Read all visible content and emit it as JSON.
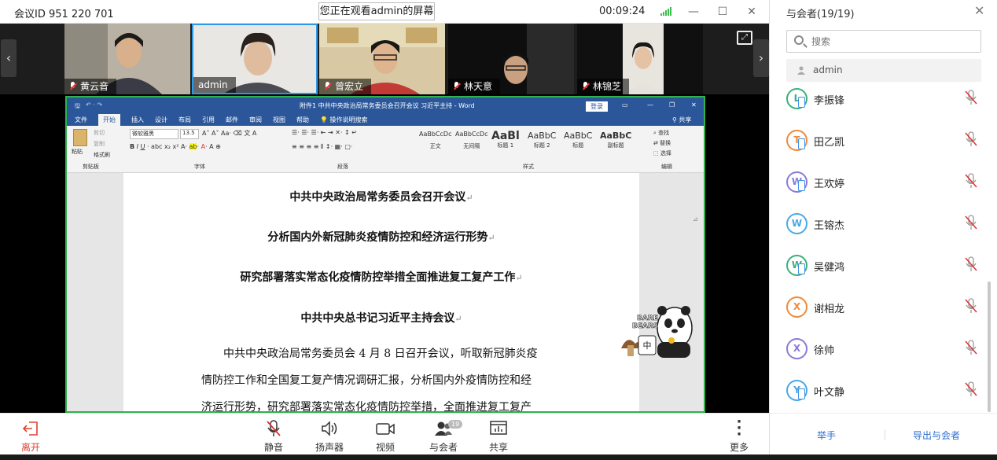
{
  "titlebar": {
    "meeting_id": "会议ID 951 220 701",
    "viewing": "您正在观看admin的屏幕",
    "timer": "00:09:24"
  },
  "video_strip": {
    "tiles": [
      {
        "name": "黄云音"
      },
      {
        "name": "admin"
      },
      {
        "name": "曾宏立"
      },
      {
        "name": "林天意"
      },
      {
        "name": "林锦芝"
      }
    ]
  },
  "word": {
    "title": "附件1  中共中央政治局常务委员会召开会议 习近平主持 - Word",
    "login": "登录",
    "tabs": [
      "文件",
      "开始",
      "插入",
      "设计",
      "布局",
      "引用",
      "邮件",
      "审阅",
      "视图",
      "帮助",
      "操作说明搜索"
    ],
    "share": "共享",
    "font_name": "微软雅黑",
    "font_size": "13.5",
    "paste": "粘贴",
    "cut": "剪切",
    "copy": "复制",
    "format_painter": "格式刷",
    "find": "查找",
    "replace": "替换",
    "select": "选择",
    "groups": [
      "剪贴板",
      "字体",
      "段落",
      "样式",
      "编辑"
    ],
    "styles": [
      {
        "sample": "AaBbCcDc",
        "name": "正文"
      },
      {
        "sample": "AaBbCcDc",
        "name": "无间隔"
      },
      {
        "sample": "AaBl",
        "name": "标题 1"
      },
      {
        "sample": "AaBbC",
        "name": "标题 2"
      },
      {
        "sample": "AaBbC",
        "name": "标题"
      },
      {
        "sample": "AaBbC",
        "name": "副标题"
      }
    ],
    "doc": {
      "h1": "中共中央政治局常务委员会召开会议",
      "h2": "分析国内外新冠肺炎疫情防控和经济运行形势",
      "h3": "研究部署落实常态化疫情防控举措全面推进复工复产工作",
      "h4": "中共中央总书记习近平主持会议",
      "p1": "中共中央政治局常务委员会 4 月 8 日召开会议，听取新冠肺炎疫",
      "p2": "情防控工作和全国复工复产情况调研汇报，分析国内外疫情防控和经",
      "p3": "济运行形势，研究部署落实常态化疫情防控举措，全面推进复工复产",
      "return_mark": "↵"
    },
    "sticker": {
      "text1": "BARE",
      "text2": "BEARS",
      "text3": "中"
    }
  },
  "toolbar": {
    "leave": "离开",
    "mute": "静音",
    "speaker": "扬声器",
    "video": "视频",
    "participants": "与会者",
    "participants_badge": "19",
    "share": "共享",
    "more": "更多"
  },
  "panel": {
    "title": "与会者(19/19)",
    "search_placeholder": "搜索",
    "host": "admin",
    "participants": [
      {
        "initial": "L",
        "name": "李振锋",
        "color": "#3ab07a"
      },
      {
        "initial": "T",
        "name": "田乙凯",
        "color": "#f08a3c"
      },
      {
        "initial": "W",
        "name": "王欢婷",
        "color": "#8a7ad8"
      },
      {
        "initial": "W",
        "name": "王镕杰",
        "color": "#4aa8e6"
      },
      {
        "initial": "W",
        "name": "吴健鸿",
        "color": "#3ab07a"
      },
      {
        "initial": "X",
        "name": "谢相龙",
        "color": "#f08a3c"
      },
      {
        "initial": "X",
        "name": "徐帅",
        "color": "#8a7ad8"
      },
      {
        "initial": "Y",
        "name": "叶文静",
        "color": "#4aa8e6"
      }
    ],
    "raise_hand": "举手",
    "export": "导出与会者"
  },
  "colors": {
    "accent": "#2d6fcf",
    "word_blue": "#2b579a",
    "share_border": "#2eb34f",
    "leave_red": "#e0402f",
    "mute_red": "#e03030"
  }
}
